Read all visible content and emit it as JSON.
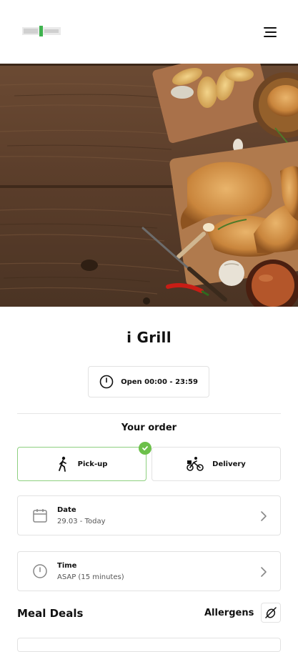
{
  "header": {
    "logo_icon": "igrill-logo",
    "menu_icon": "hamburger-icon"
  },
  "hero": {
    "image_icon": "grilled-chicken-photo"
  },
  "restaurant": {
    "name": "i Grill",
    "hours": "Open 00:00 - 23:59"
  },
  "order": {
    "heading": "Your order",
    "pickup_label": "Pick-up",
    "delivery_label": "Delivery",
    "selected": "pickup",
    "date_label": "Date",
    "date_value": "29.03 - Today",
    "time_label": "Time",
    "time_value": "ASAP (15 minutes)"
  },
  "menu": {
    "section_title": "Meal Deals",
    "allergens_label": "Allergens"
  },
  "colors": {
    "accent_green": "#6cc04a",
    "selected_border": "#8ed07f",
    "border": "#e2e2e2"
  }
}
